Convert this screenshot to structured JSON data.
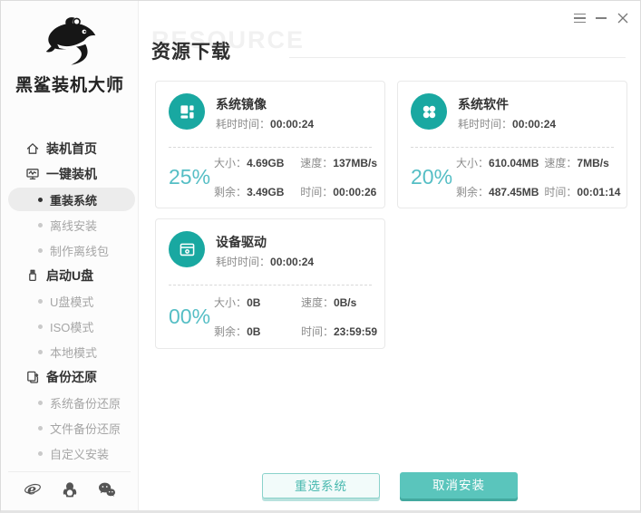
{
  "window": {
    "app_name": "黑鲨装机大师",
    "controls": {
      "menu": "menu",
      "minimize": "minimize",
      "close": "close"
    }
  },
  "colors": {
    "accent_teal": "#19a8a1",
    "percent_teal": "#55bec5",
    "cancel_button_fill": "#5ac5bc",
    "cancel_button_edge": "#43a99f",
    "active_item_bg": "#ececec"
  },
  "sidebar": {
    "brand": "黑鲨装机大师",
    "items": [
      {
        "label": "装机首页",
        "type": "section",
        "icon": "home-icon",
        "active": false
      },
      {
        "label": "一键装机",
        "type": "section",
        "icon": "monitor-icon",
        "active": false
      },
      {
        "label": "重装系统",
        "type": "sub",
        "active": true
      },
      {
        "label": "离线安装",
        "type": "sub",
        "active": false
      },
      {
        "label": "制作离线包",
        "type": "sub",
        "active": false
      },
      {
        "label": "启动U盘",
        "type": "section",
        "icon": "usb-icon",
        "active": false
      },
      {
        "label": "U盘模式",
        "type": "sub",
        "active": false
      },
      {
        "label": "ISO模式",
        "type": "sub",
        "active": false
      },
      {
        "label": "本地模式",
        "type": "sub",
        "active": false
      },
      {
        "label": "备份还原",
        "type": "section",
        "icon": "backup-icon",
        "active": false
      },
      {
        "label": "系统备份还原",
        "type": "sub",
        "active": false
      },
      {
        "label": "文件备份还原",
        "type": "sub",
        "active": false
      },
      {
        "label": "自定义安装",
        "type": "sub",
        "active": false
      }
    ],
    "footer_icons": [
      "ie-icon",
      "qq-icon",
      "wechat-icon"
    ]
  },
  "header": {
    "title": "资源下载",
    "watermark": "RESOURCE"
  },
  "cards": [
    {
      "title": "系统镜像",
      "icon": "system-image-icon",
      "elapsed_label": "耗时时间：",
      "elapsed": "00:00:24",
      "percent": "25%",
      "stats": [
        {
          "label": "大小：",
          "value": "4.69GB"
        },
        {
          "label": "速度：",
          "value": "137MB/s"
        },
        {
          "label": "剩余：",
          "value": "3.49GB"
        },
        {
          "label": "时间：",
          "value": "00:00:26"
        }
      ]
    },
    {
      "title": "系统软件",
      "icon": "system-software-icon",
      "elapsed_label": "耗时时间：",
      "elapsed": "00:00:24",
      "percent": "20%",
      "stats": [
        {
          "label": "大小：",
          "value": "610.04MB"
        },
        {
          "label": "速度：",
          "value": "7MB/s"
        },
        {
          "label": "剩余：",
          "value": "487.45MB"
        },
        {
          "label": "时间：",
          "value": "00:01:14"
        }
      ]
    },
    {
      "title": "设备驱动",
      "icon": "device-driver-icon",
      "elapsed_label": "耗时时间：",
      "elapsed": "00:00:24",
      "percent": "00%",
      "stats": [
        {
          "label": "大小：",
          "value": "0B"
        },
        {
          "label": "速度：",
          "value": "0B/s"
        },
        {
          "label": "剩余：",
          "value": "0B"
        },
        {
          "label": "时间：",
          "value": "23:59:59"
        }
      ]
    }
  ],
  "actions": {
    "reselect": "重选系统",
    "cancel": "取消安装"
  }
}
